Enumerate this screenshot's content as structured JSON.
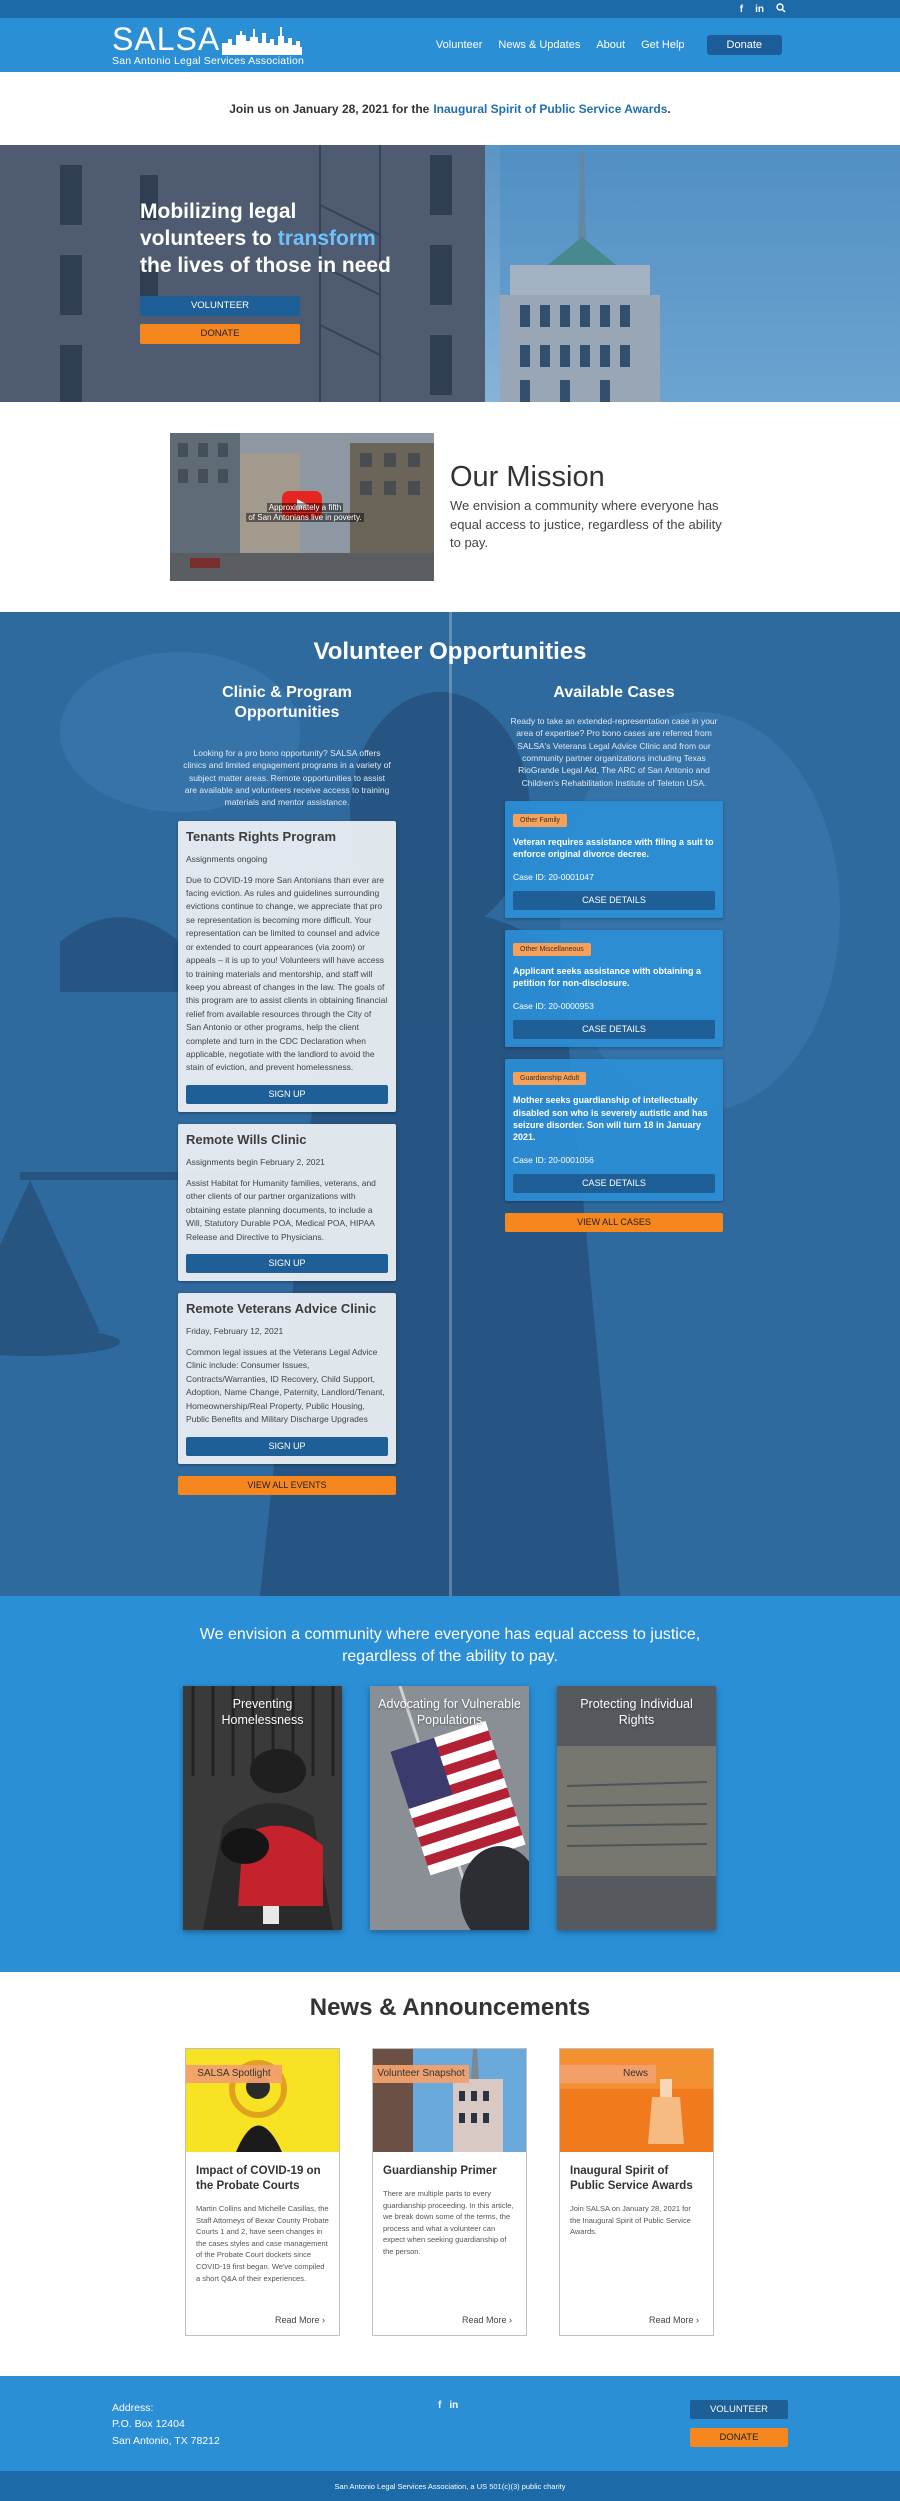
{
  "topbar": {
    "icons": [
      "facebook-icon",
      "linkedin-icon",
      "search-icon"
    ],
    "facebook": "f",
    "linkedin": "in",
    "search": "⌕"
  },
  "header": {
    "logo_word": "SALSA",
    "logo_sub": "San Antonio Legal Services Association",
    "nav": [
      "Volunteer",
      "News & Updates",
      "About",
      "Get Help"
    ],
    "donate": "Donate"
  },
  "announcement": {
    "text": "Join us on January 28, 2021 for the",
    "link": "Inaugural Spirit of Public Service Awards",
    "end": "."
  },
  "hero": {
    "title_a": "Mobilizing legal volunteers to ",
    "title_hl": "transform",
    "title_b": " the lives of those in need",
    "volunteer": "VOLUNTEER",
    "donate": "DONATE"
  },
  "mission": {
    "video_caption_1": "Approximately a fifth",
    "video_caption_2": "of San Antonians live in poverty.",
    "title": "Our Mission",
    "body": "We envision a community where everyone has equal access to justice, regardless of the ability to pay."
  },
  "volunteer": {
    "title": "Volunteer Opportunities",
    "left_head": "Clinic & Program Opportunities",
    "left_intro": "Looking for a pro bono opportunity? SALSA offers clinics and limited engagement programs in a variety of subject matter areas. Remote opportunities to assist are available and volunteers receive access to training materials and mentor assistance.",
    "events": [
      {
        "title": "Tenants Rights Program",
        "date": "Assignments ongoing",
        "body": "Due to COVID-19 more San Antonians than ever are facing eviction. As rules and guidelines surrounding evictions continue to change, we appreciate that pro se representation is becoming more difficult. Your representation can be limited to counsel and advice or extended to court appearances (via zoom) or appeals – it is up to you! Volunteers will have access to training materials and mentorship, and staff will keep you abreast of changes in the law. The goals of this program are to assist clients in obtaining financial relief from available resources through the City of San Antonio or other programs, help the client complete and turn in the CDC Declaration when applicable, negotiate with the landlord to avoid the stain of eviction, and prevent homelessness.",
        "button": "SIGN UP"
      },
      {
        "title": "Remote Wills Clinic",
        "date": "Assignments begin February 2, 2021",
        "body": "Assist Habitat for Humanity families, veterans, and other clients of our partner organizations with obtaining estate planning documents, to include a Will, Statutory Durable POA, Medical POA, HIPAA Release and Directive to Physicians.",
        "button": "SIGN UP"
      },
      {
        "title": "Remote Veterans Advice Clinic",
        "date": "Friday, February 12, 2021",
        "body": "Common legal issues at the Veterans Legal Advice Clinic include: Consumer Issues, Contracts/Warranties, ID Recovery, Child Support, Adoption, Name Change, Paternity, Landlord/Tenant, Homeownership/Real Property, Public Housing, Public Benefits and Military Discharge Upgrades",
        "button": "SIGN UP"
      }
    ],
    "view_all_events": "VIEW ALL EVENTS",
    "right_head": "Available Cases",
    "right_intro": "Ready to take an extended-representation case in your area of expertise? Pro bono cases are referred from SALSA's Veterans Legal Advice Clinic and from our community partner organizations including Texas RioGrande Legal Aid, The ARC of San Antonio and Children's Rehabilitation Institute of Teleton USA.",
    "cases": [
      {
        "tag": "Other Family",
        "text": "Veteran requires assistance with filing a suit to enforce original divorce decree.",
        "id": "Case ID: 20-0001047",
        "button": "CASE DETAILS"
      },
      {
        "tag": "Other Miscellaneous",
        "text": "Applicant seeks assistance with obtaining a petition for non-disclosure.",
        "id": "Case ID: 20-0000953",
        "button": "CASE DETAILS"
      },
      {
        "tag": "Guardianship Adult",
        "text": "Mother seeks guardianship of intellectually disabled son who is severely autistic and has seizure disorder. Son will turn 18 in January 2021.",
        "id": "Case ID: 20-0001056",
        "button": "CASE DETAILS"
      }
    ],
    "view_all_cases": "VIEW ALL CASES"
  },
  "vision": {
    "text": "We envision a community where everyone has equal access to justice, regardless of the ability to pay.",
    "cards": [
      "Preventing Homelessness",
      "Advocating for Vulnerable Populations",
      "Protecting Individual Rights"
    ]
  },
  "news": {
    "title": "News & Announcements",
    "cards": [
      {
        "badge": "SALSA Spotlight",
        "title": "Impact of COVID-19 on the Probate Courts",
        "body": "Martin Collins and Michelle Casillas, the Staff Attorneys of Bexar County Probate Courts 1 and 2, have seen changes in the cases styles and case management of the Probate Court dockets since COVID-19 first began. We've compiled a short Q&A of their experiences.",
        "more": "Read More"
      },
      {
        "badge": "Volunteer Snapshot",
        "title": "Guardianship Primer",
        "body": "There are multiple parts to every guardianship proceeding. In this article, we break down some of the terms, the process and what a volunteer can expect when seeking guardianship of the person.",
        "more": "Read More"
      },
      {
        "badge": "News",
        "title": "Inaugural Spirit of Public Service Awards",
        "body": "Join SALSA on January 28, 2021 for the Inaugural Spirit of Public Service Awards.",
        "more": "Read More"
      }
    ]
  },
  "footer": {
    "address_label": "Address:",
    "address_line1": "P.O. Box 12404",
    "address_line2": "San Antonio, TX 78212",
    "social_facebook": "f",
    "social_linkedin": "in",
    "volunteer": "VOLUNTEER",
    "donate": "DONATE",
    "copyright": "San Antonio Legal Services Association, a US 501(c)(3) public charity"
  },
  "colors": {
    "brand_blue": "#2b8fd6",
    "dark_blue": "#1d5f96",
    "orange": "#f6871f",
    "badge_orange": "#f6a05a"
  }
}
